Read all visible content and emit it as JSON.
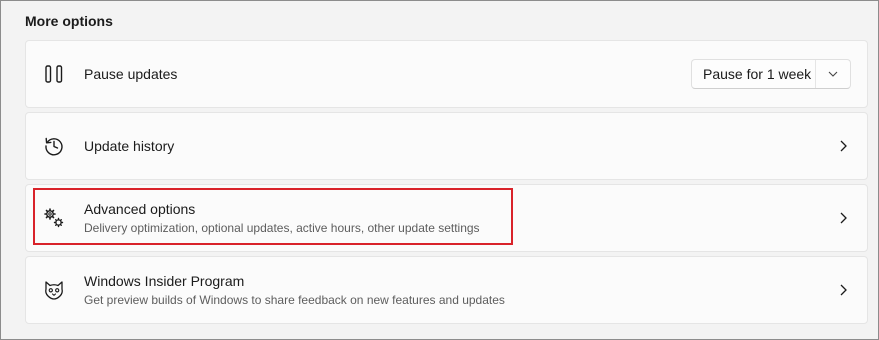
{
  "section_title": "More options",
  "items": [
    {
      "title": "Pause updates",
      "icon": "pause-icon",
      "dropdown": {
        "selected": "Pause for 1 week"
      }
    },
    {
      "title": "Update history",
      "icon": "history-icon"
    },
    {
      "title": "Advanced options",
      "subtitle": "Delivery optimization, optional updates, active hours, other update settings",
      "icon": "gears-icon"
    },
    {
      "title": "Windows Insider Program",
      "subtitle": "Get preview builds of Windows to share feedback on new features and updates",
      "icon": "insider-icon"
    }
  ],
  "colors": {
    "highlight": "#d9232a",
    "background": "#f3f3f3",
    "card": "#fbfbfb"
  }
}
